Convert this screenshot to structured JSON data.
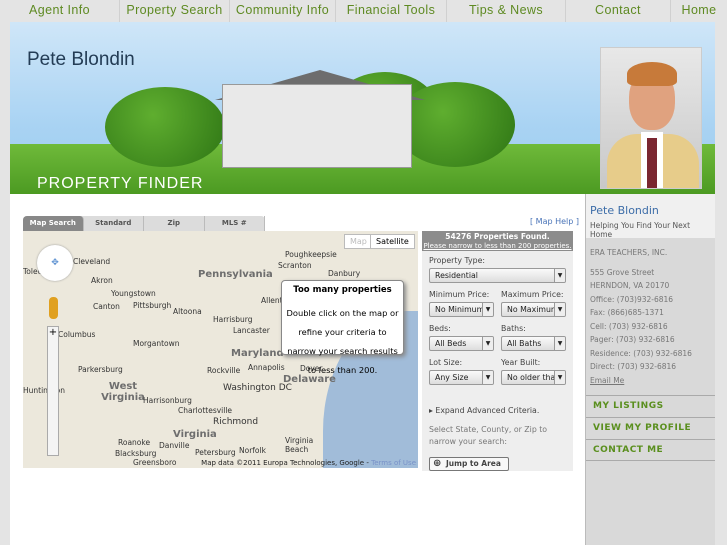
{
  "nav": [
    "Agent Info",
    "Property Search",
    "Community Info",
    "Financial Tools",
    "Tips & News",
    "Contact",
    "Home"
  ],
  "banner": {
    "name": "Pete Blondin",
    "title": "PROPERTY FINDER"
  },
  "tabs": [
    "Map Search",
    "Standard",
    "Zip",
    "MLS #"
  ],
  "map_help": "[ Map Help ]",
  "map": {
    "map_button": "Map",
    "satellite_button": "Satellite",
    "states": [
      "Pennsylvania",
      "Maryland",
      "Delaware",
      "West Virginia",
      "Virginia"
    ],
    "cities": [
      "Cleveland",
      "Toledo",
      "Akron",
      "Youngstown",
      "Canton",
      "Pittsburgh",
      "Altoona",
      "Harrisburg",
      "Lancaster",
      "Scranton",
      "Danbury",
      "Allentown",
      "Columbus",
      "Morgantown",
      "Parkersburg",
      "Huntington",
      "Rockville",
      "Annapolis",
      "Washington DC",
      "Dover",
      "Harrisonburg",
      "Charlottesville",
      "Richmond",
      "Roanoke",
      "Blacksburg",
      "Petersburg",
      "Danville",
      "Norfolk",
      "Virginia Beach",
      "Poughkeepsie",
      "Greensboro"
    ],
    "popup_title": "Too many properties",
    "popup_text": "Double click on the map or refine your criteria to narrow your search results to less than 200.",
    "credit": "Map data ©2011 Europa Technologies, Google -",
    "terms": "Terms of Use"
  },
  "criteria": {
    "found": "54276 Properties Found.",
    "narrow": "Please narrow to less than 200 properties.",
    "property_type_label": "Property Type:",
    "property_type": "Residential",
    "min_price_label": "Minimum Price:",
    "min_price": "No Minimum",
    "max_price_label": "Maximum Price:",
    "max_price": "No Maximum",
    "beds_label": "Beds:",
    "beds": "All Beds",
    "baths_label": "Baths:",
    "baths": "All Baths",
    "lot_label": "Lot Size:",
    "lot": "Any Size",
    "year_label": "Year Built:",
    "year": "No older than",
    "advanced": "▸ Expand Advanced Criteria.",
    "select_text": "Select State, County, or Zip to narrow your search:",
    "jump": "Jump to Area"
  },
  "agent": {
    "name": "Pete Blondin",
    "tagline": "Helping You Find Your Next Home",
    "company": "ERA TEACHERS, INC.",
    "lines": [
      "555 Grove Street",
      "HERNDON, VA 20170",
      "Office: (703)932-6816",
      "Fax: (866)685-1371",
      "Cell: (703) 932-6816",
      "Pager: (703) 932-6816",
      "Residence: (703) 932-6816",
      "Direct: (703) 932-6816"
    ],
    "email": "Email Me",
    "links": [
      "MY LISTINGS",
      "VIEW MY PROFILE",
      "CONTACT ME"
    ]
  }
}
